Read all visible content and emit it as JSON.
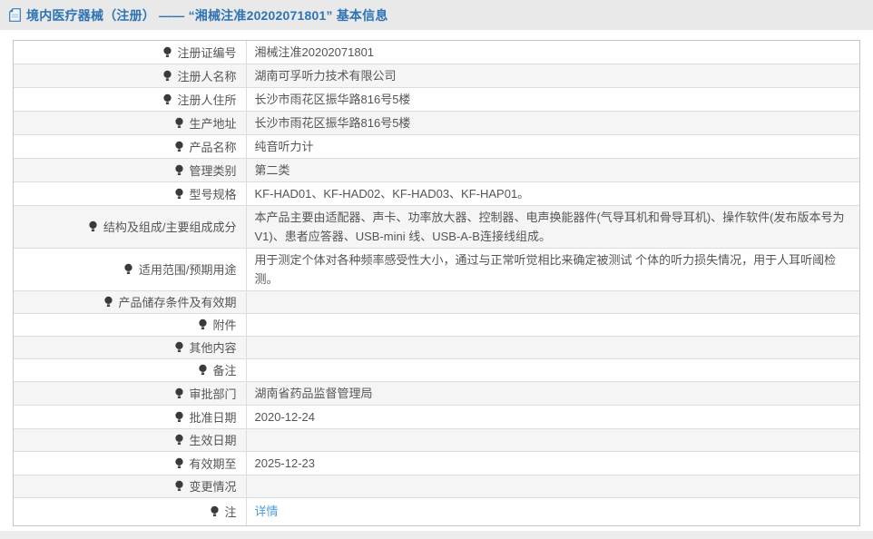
{
  "header": {
    "icon": "document-icon",
    "title": "境内医疗器械（注册） —— “湘械注准20202071801” 基本信息"
  },
  "table": {
    "rows": [
      {
        "label": "注册证编号",
        "value": "湘械注准20202071801"
      },
      {
        "label": "注册人名称",
        "value": "湖南可孚听力技术有限公司"
      },
      {
        "label": "注册人住所",
        "value": "长沙市雨花区振华路816号5楼"
      },
      {
        "label": "生产地址",
        "value": "长沙市雨花区振华路816号5楼"
      },
      {
        "label": "产品名称",
        "value": "纯音听力计"
      },
      {
        "label": "管理类别",
        "value": "第二类"
      },
      {
        "label": "型号规格",
        "value": "KF-HAD01、KF-HAD02、KF-HAD03、KF-HAP01。"
      },
      {
        "label": "结构及组成/主要组成成分",
        "value": "本产品主要由适配器、声卡、功率放大器、控制器、电声换能器件(气导耳机和骨导耳机)、操作软件(发布版本号为V1)、患者应答器、USB-mini 线、USB-A-B连接线组成。"
      },
      {
        "label": "适用范围/预期用途",
        "value": "用于测定个体对各种频率感受性大小，通过与正常听觉相比来确定被测试 个体的听力损失情况，用于人耳听阈检测。"
      },
      {
        "label": "产品储存条件及有效期",
        "value": ""
      },
      {
        "label": "附件",
        "value": ""
      },
      {
        "label": "其他内容",
        "value": ""
      },
      {
        "label": "备注",
        "value": ""
      },
      {
        "label": "审批部门",
        "value": "湖南省药品监督管理局"
      },
      {
        "label": "批准日期",
        "value": "2020-12-24"
      },
      {
        "label": "生效日期",
        "value": ""
      },
      {
        "label": "有效期至",
        "value": "2025-12-23"
      },
      {
        "label": "变更情况",
        "value": ""
      },
      {
        "label": "注",
        "icon": "bulb-icon",
        "link": "详情"
      }
    ]
  },
  "colors": {
    "accent": "#2e74b5",
    "link": "#4a9eda",
    "topbar_bg": "#e9e9e9",
    "row_alt_bg": "#f5f5f5",
    "border_outer": "#c5c5c5",
    "border_inner": "#dddddd",
    "text": "#555555"
  }
}
